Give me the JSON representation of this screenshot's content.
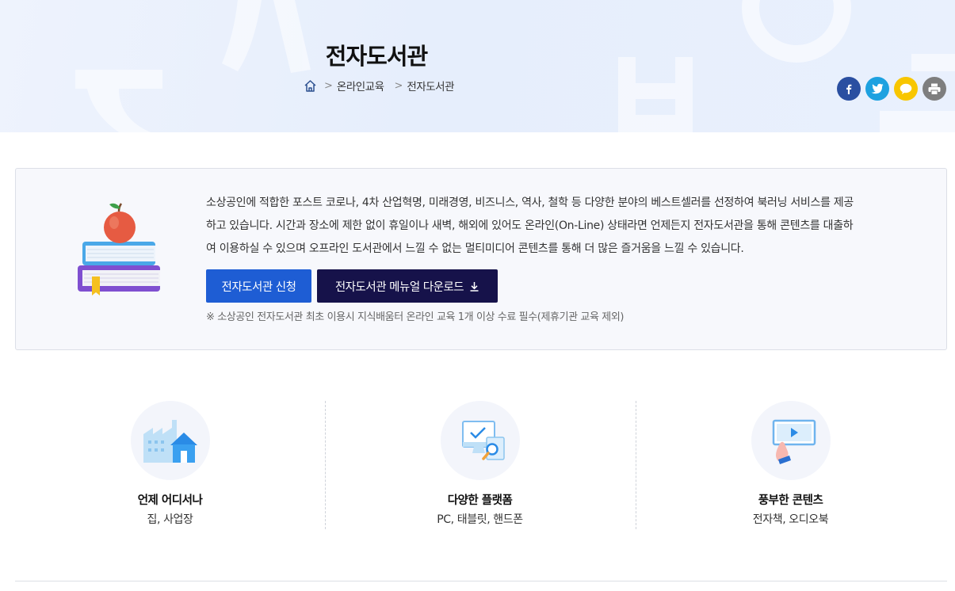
{
  "header": {
    "title": "전자도서관",
    "breadcrumb": [
      "온라인교육",
      "전자도서관"
    ],
    "share": [
      {
        "name": "facebook",
        "icon": "facebook-icon",
        "color": "#2a4fa1"
      },
      {
        "name": "twitter",
        "icon": "twitter-icon",
        "color": "#1da1e0"
      },
      {
        "name": "kakaotalk",
        "icon": "kakaotalk-icon",
        "color": "#f8c600"
      },
      {
        "name": "print",
        "icon": "print-icon",
        "color": "#7e7e7e"
      }
    ]
  },
  "intro": {
    "lines": [
      "소상공인에 적합한 포스트 코로나, 4차 산업혁명, 미래경영, 비즈니스, 역사, 철학 등 다양한 분야의 베스트셀러를 선정하여 북러닝 서비스를 제공",
      "하고 있습니다. 시간과 장소에 제한 없이 휴일이나 새벽, 해외에 있어도 온라인(On-Line) 상태라면 언제든지 전자도서관을 통해 콘텐츠를 대출하",
      "여 이용하실 수 있으며 오프라인 도서관에서 느낄 수 없는 멀티미디어 콘텐츠를 통해 더 많은 즐거움을 느낄 수 있습니다."
    ],
    "apply_label": "전자도서관 신청",
    "download_label": "전자도서관 메뉴얼 다운로드",
    "note": "※ 소상공인 전자도서관 최초 이용시 지식배움터 온라인 교육 1개 이상 수료 필수(제휴기관 교육 제외)",
    "accent_blue": "#1e5dd4",
    "accent_navy": "#16124a"
  },
  "features": [
    {
      "title": "언제 어디서나",
      "subtitle": "집, 사업장",
      "icon": "building-home-icon"
    },
    {
      "title": "다양한 플랫폼",
      "subtitle": "PC, 태블릿, 핸드폰",
      "icon": "devices-icon"
    },
    {
      "title": "풍부한 콘텐츠",
      "subtitle": "전자책, 오디오북",
      "icon": "video-screen-icon"
    }
  ]
}
